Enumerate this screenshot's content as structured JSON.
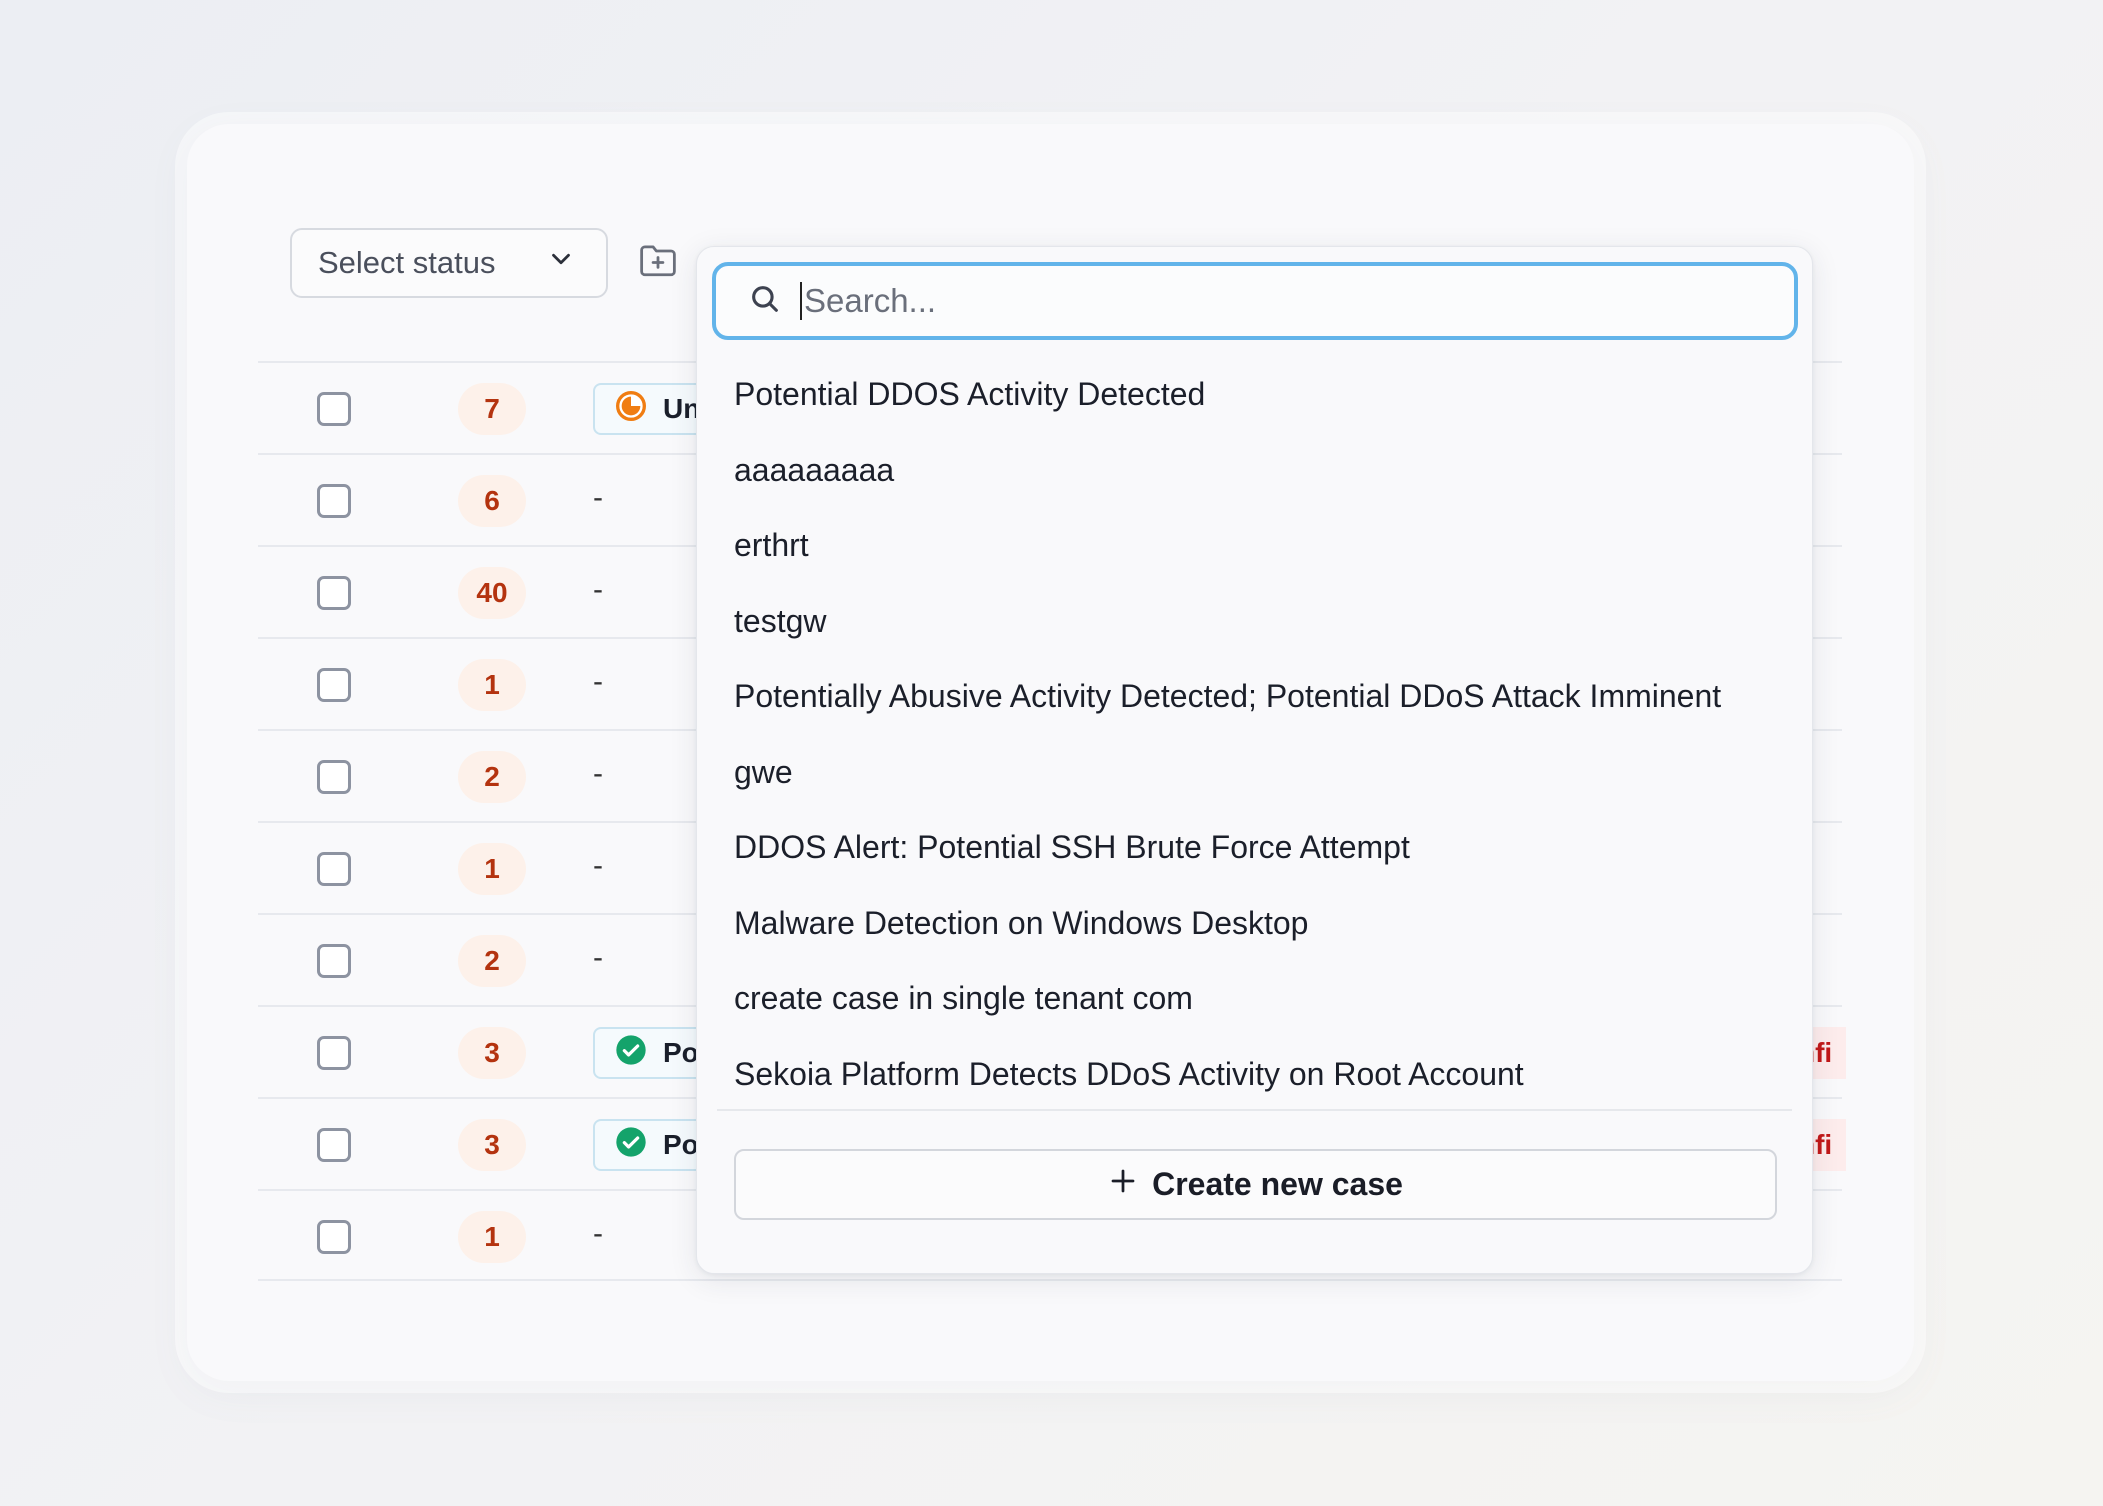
{
  "toolbar": {
    "status_select": {
      "placeholder": "Select status",
      "icon": "chevron-down-icon"
    },
    "add_to_case_icon": "folder-plus-icon"
  },
  "table": {
    "rows": [
      {
        "count": "7",
        "status": "Un",
        "status_icon": "half-circle-icon",
        "status_color": "#f07d12",
        "right_tag": ""
      },
      {
        "count": "6",
        "status": "-"
      },
      {
        "count": "40",
        "status": "-"
      },
      {
        "count": "1",
        "status": "-"
      },
      {
        "count": "2",
        "status": "-"
      },
      {
        "count": "1",
        "status": "-"
      },
      {
        "count": "2",
        "status": "-"
      },
      {
        "count": "3",
        "status": "Po",
        "status_icon": "check-circle-icon",
        "status_color": "#14a36b",
        "right_tag": "nfi"
      },
      {
        "count": "3",
        "status": "Po",
        "status_icon": "check-circle-icon",
        "status_color": "#14a36b",
        "right_tag": "nfi"
      },
      {
        "count": "1",
        "status": "-"
      }
    ]
  },
  "case_dropdown": {
    "search_placeholder": "Search...",
    "options": [
      "Potential DDOS Activity Detected",
      "aaaaaaaaa",
      "erthrt",
      "testgw",
      "Potentially Abusive Activity Detected; Potential DDoS Attack Imminent",
      "gwe",
      "DDOS Alert: Potential SSH Brute Force Attempt",
      "Malware Detection on Windows Desktop",
      "create case in single tenant com",
      "Sekoia Platform Detects DDoS Activity on Root Account"
    ],
    "create_label": "Create new case"
  },
  "colors": {
    "accent_focus": "#62b4ea",
    "count_text": "#b4330f",
    "count_bg": "#fdf1ea",
    "success": "#14a36b",
    "warning": "#f07d12"
  }
}
